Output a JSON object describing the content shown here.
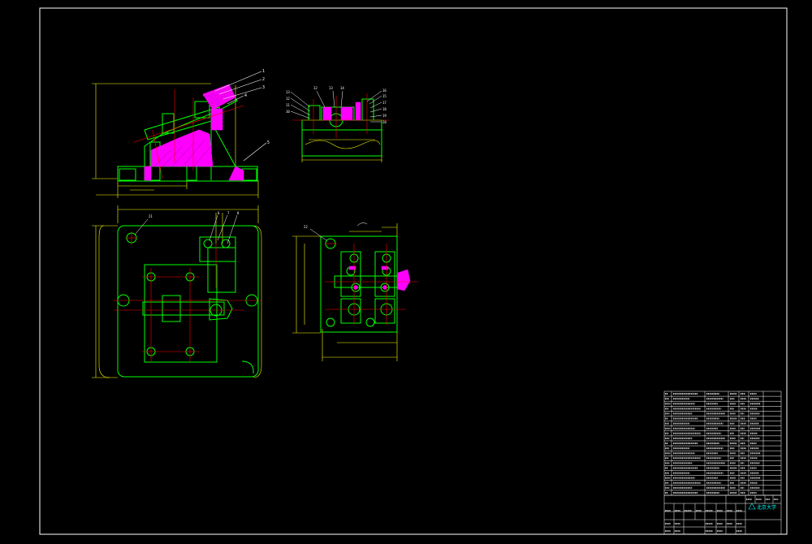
{
  "drawing": {
    "colors": {
      "background": "#000000",
      "frame": "#ffffff",
      "outline": "#00ff00",
      "dimension": "#ffff00",
      "centerline": "#ff0000",
      "section_fill": "#ff00ff",
      "hidden": "#00ffff",
      "text": "#ffffff"
    },
    "front_view": {
      "balloons": [
        "1",
        "2",
        "3",
        "4",
        "5"
      ]
    },
    "side_view": {
      "balloons_left": [
        "13",
        "12",
        "11",
        "10"
      ],
      "balloons_top": [
        "12",
        "13",
        "14"
      ],
      "balloons_right": [
        "16",
        "15",
        "17",
        "18",
        "19",
        "20"
      ]
    },
    "top_view": {
      "balloons": [
        "21",
        "6",
        "7",
        "8"
      ]
    },
    "detail_view": {
      "balloons": [
        "22"
      ]
    },
    "title_block": {
      "logo_text": "北京大学"
    }
  }
}
